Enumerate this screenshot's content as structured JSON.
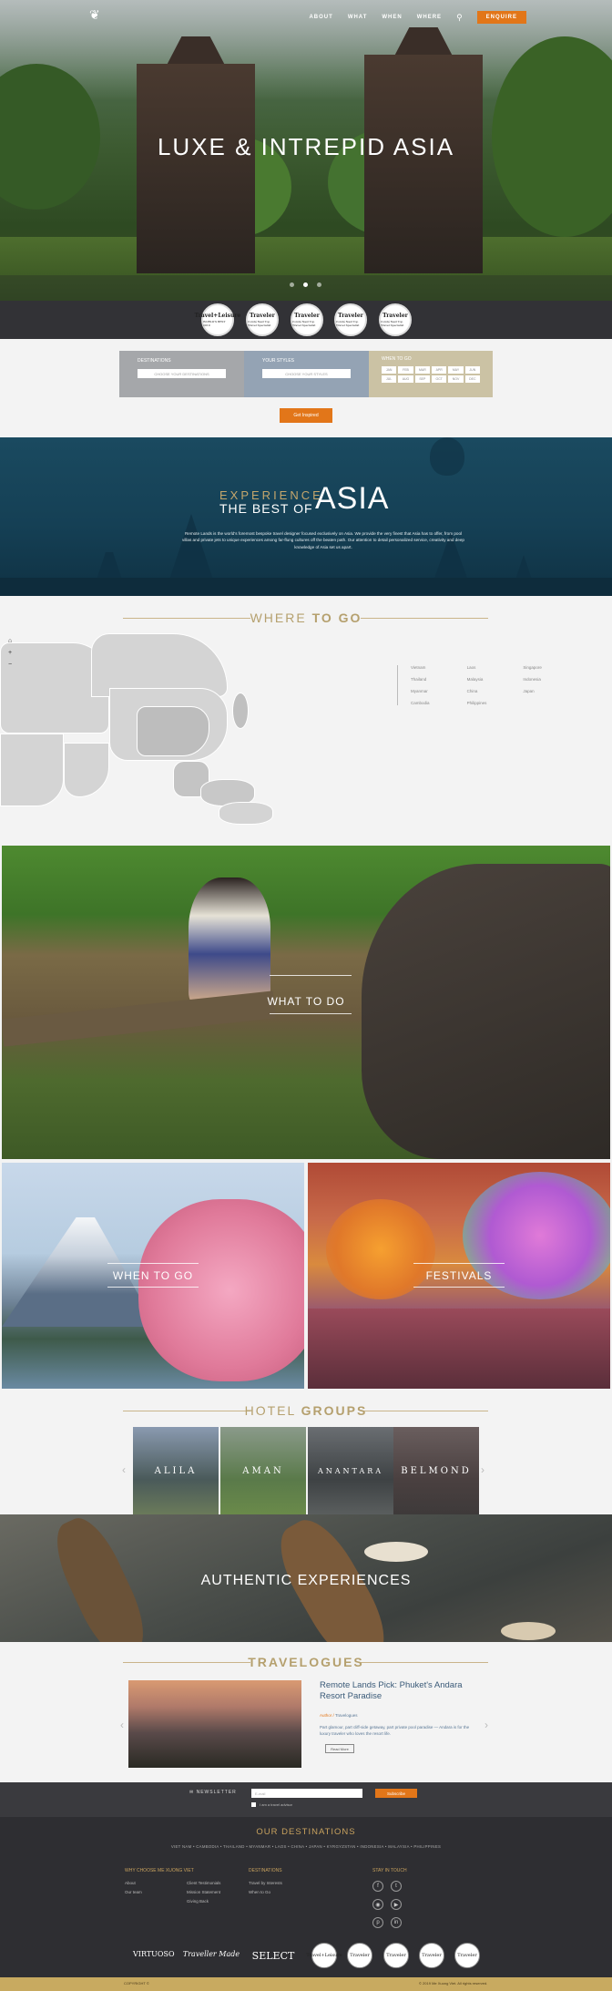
{
  "header": {
    "nav": [
      "ABOUT",
      "WHAT",
      "WHEN",
      "WHERE"
    ],
    "enquire_label": "ENQUIRE",
    "hero_title": "LUXE & INTREPID ASIA"
  },
  "awards": [
    {
      "big": "Travel+Leisure",
      "small": "WORLD'S BEST 2019"
    },
    {
      "big": "Traveler",
      "small": "Condé Nast Top Travel Specialist"
    },
    {
      "big": "Traveler",
      "small": "Condé Nast Top Travel Specialist"
    },
    {
      "big": "Traveler",
      "small": "Condé Nast Top Travel Specialist"
    },
    {
      "big": "Traveler",
      "small": "Condé Nast Top Travel Specialist"
    }
  ],
  "search": {
    "destinations_label": "DESTINATIONS",
    "destinations_placeholder": "CHOOSE YOUR DESTINATIONS",
    "styles_label": "YOUR STYLES",
    "styles_placeholder": "CHOOSE YOUR STYLES",
    "when_label": "WHEN TO GO",
    "months": [
      "JAN",
      "FEB",
      "MAR",
      "APR",
      "MAY",
      "JUN",
      "JUL",
      "AUG",
      "SEP",
      "OCT",
      "NOV",
      "DEC"
    ],
    "button_label": "Get Inspired"
  },
  "experience": {
    "small": "EXPERIENCE",
    "best": "THE BEST OF",
    "big": "ASIA",
    "text": "Remote Lands is the world's foremost bespoke travel designer focused exclusively on Asia. We provide the very finest that Asia has to offer, from pool villas and private jets to unique experiences among far-flung cultures off the beaten path. Our attention to detail personalized service, creativity and deep knowledge of Asia set us apart."
  },
  "where": {
    "title_light": "WHERE ",
    "title_bold": "TO GO",
    "destinations": [
      "Vietnam",
      "Laos",
      "Singapore",
      "Thailand",
      "Malaysia",
      "Indonesia",
      "Myanmar",
      "China",
      "Japan",
      "Cambodia",
      "Philippines",
      ""
    ]
  },
  "what_label": "WHAT TO DO",
  "when_label": "WHEN TO GO",
  "festivals_label": "FESTIVALS",
  "hotels": {
    "title_light": "HOTEL ",
    "title_bold": "GROUPS",
    "brands": [
      "ALILA",
      "AMAN",
      "ANANTARA",
      "BELMOND"
    ]
  },
  "authentic_label": "AUTHENTIC EXPERIENCES",
  "travelogues": {
    "title": "TRAVELOGUES",
    "post_title": "Remote Lands Pick: Phuket's Andara Resort Paradise",
    "author_prefix": "Author",
    "author": "Travelogues",
    "desc": "Part glamour, part cliff-side getaway, part private pool paradise — Andara is for the luxury traveler who loves the resort life.",
    "read_more": "Read More"
  },
  "newsletter": {
    "label": "NEWSLETTER",
    "email_placeholder": "E-mail",
    "subscribe": "Subscribe",
    "checkbox_label": "I am a travel advisor"
  },
  "footer": {
    "destinations_title": "OUR DESTINATIONS",
    "countries": "VIET NAM  •  CAMBODIA  •  THAILAND  •  MYANMAR  •  LAOS  •  CHINA  •  JAPAN  •  KYRGYZSTAN  •  INDONESIA  •  MALAYSIA  •  PHILIPPINES",
    "col1_title": "WHY CHOOSE ME XUONG VIET",
    "col1_links": [
      "About",
      "Our team"
    ],
    "col1b_links": [
      "Client Testimonials",
      "Mission Statement",
      "Giving Back"
    ],
    "col2_title": "DESTINATIONS",
    "col2_links": [
      "Travel by Interests",
      "When to Go"
    ],
    "col3_title": "STAY IN TOUCH",
    "partners": [
      "VIRTUOSO",
      "Traveller Made",
      "SELECT"
    ],
    "badges": [
      "Travel+Leisure",
      "Traveler",
      "Traveler",
      "Traveler",
      "Traveler"
    ],
    "copy_left": "COPYRIGHT ©",
    "copy_right": "© 2019 Me Xuong Viet. All rights reserved."
  },
  "colors": {
    "accent": "#e27619",
    "gold": "#b5a06e",
    "dark": "#2e2e32",
    "teal": "#1a4a60"
  }
}
